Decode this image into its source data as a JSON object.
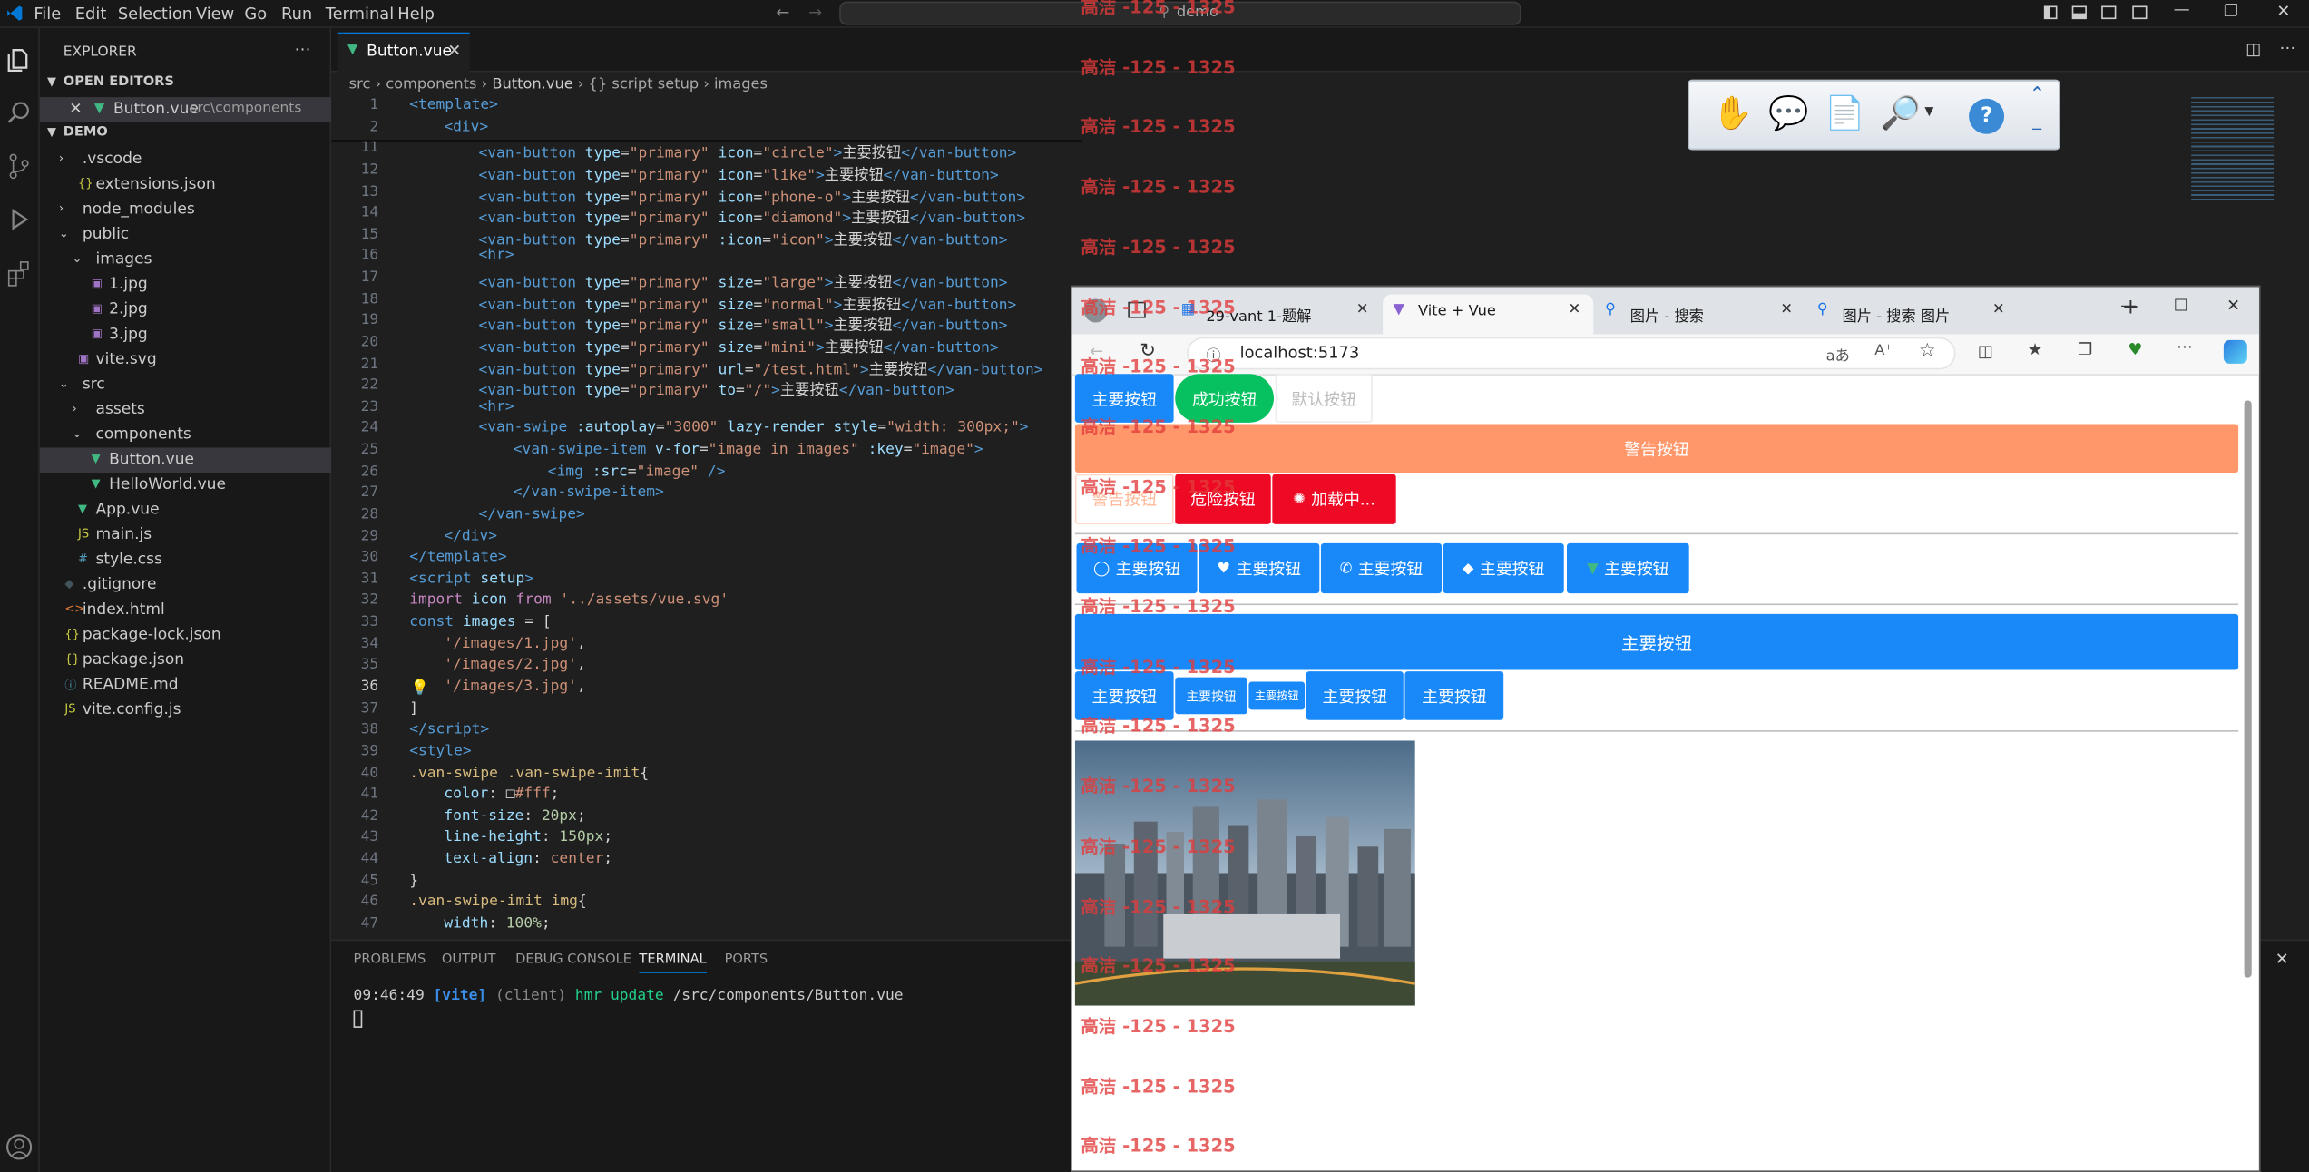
{
  "menu": [
    "File",
    "Edit",
    "Selection",
    "View",
    "Go",
    "Run",
    "Terminal",
    "Help"
  ],
  "search": {
    "text": "demo"
  },
  "explorer": {
    "title": "EXPLORER",
    "open_editors_label": "OPEN EDITORS",
    "open_file": "Button.vue",
    "open_file_path": "src\\components",
    "project": "DEMO",
    "items": [
      ".vscode",
      "extensions.json",
      "node_modules",
      "public",
      "images",
      "1.jpg",
      "2.jpg",
      "3.jpg",
      "vite.svg",
      "src",
      "assets",
      "components",
      "Button.vue",
      "HelloWorld.vue",
      "App.vue",
      "main.js",
      "style.css",
      ".gitignore",
      "index.html",
      "package-lock.json",
      "package.json",
      "README.md",
      "vite.config.js"
    ]
  },
  "editor": {
    "tab_label": "Button.vue",
    "breadcrumb": [
      "src",
      "components",
      "Button.vue",
      "{} script setup",
      "images"
    ],
    "lines": [
      {
        "n": "1",
        "html": "<span class='tag'>&lt;template&gt;</span>",
        "indent": 0
      },
      {
        "n": "2",
        "html": "<span class='tag'>&lt;div&gt;</span>",
        "indent": 1
      },
      {
        "n": "11",
        "html": "<span class='tag'>&lt;van-button</span> <span class='attr'>type</span>=<span class='str'>\"primary\"</span> <span class='attr'>icon</span>=<span class='str'>\"circle\"</span><span class='tag'>&gt;</span><span class='txt'>主要按钮</span><span class='tag'>&lt;/van-button&gt;</span>",
        "indent": 2
      },
      {
        "n": "12",
        "html": "<span class='tag'>&lt;van-button</span> <span class='attr'>type</span>=<span class='str'>\"primary\"</span> <span class='attr'>icon</span>=<span class='str'>\"like\"</span><span class='tag'>&gt;</span><span class='txt'>主要按钮</span><span class='tag'>&lt;/van-button&gt;</span>",
        "indent": 2
      },
      {
        "n": "13",
        "html": "<span class='tag'>&lt;van-button</span> <span class='attr'>type</span>=<span class='str'>\"primary\"</span> <span class='attr'>icon</span>=<span class='str'>\"phone-o\"</span><span class='tag'>&gt;</span><span class='txt'>主要按钮</span><span class='tag'>&lt;/van-button&gt;</span>",
        "indent": 2
      },
      {
        "n": "14",
        "html": "<span class='tag'>&lt;van-button</span> <span class='attr'>type</span>=<span class='str'>\"primary\"</span> <span class='attr'>icon</span>=<span class='str'>\"diamond\"</span><span class='tag'>&gt;</span><span class='txt'>主要按钮</span><span class='tag'>&lt;/van-button&gt;</span>",
        "indent": 2
      },
      {
        "n": "15",
        "html": "<span class='tag'>&lt;van-button</span> <span class='attr'>type</span>=<span class='str'>\"primary\"</span> <span class='attr'>:icon</span>=<span class='str'>\"icon\"</span><span class='tag'>&gt;</span><span class='txt'>主要按钮</span><span class='tag'>&lt;/van-button&gt;</span>",
        "indent": 2
      },
      {
        "n": "16",
        "html": "<span class='tag'>&lt;hr&gt;</span>",
        "indent": 2
      },
      {
        "n": "17",
        "html": "<span class='tag'>&lt;van-button</span> <span class='attr'>type</span>=<span class='str'>\"primary\"</span> <span class='attr'>size</span>=<span class='str'>\"large\"</span><span class='tag'>&gt;</span><span class='txt'>主要按钮</span><span class='tag'>&lt;/van-button&gt;</span>",
        "indent": 2
      },
      {
        "n": "18",
        "html": "<span class='tag'>&lt;van-button</span> <span class='attr'>type</span>=<span class='str'>\"primary\"</span> <span class='attr'>size</span>=<span class='str'>\"normal\"</span><span class='tag'>&gt;</span><span class='txt'>主要按钮</span><span class='tag'>&lt;/van-button&gt;</span>",
        "indent": 2
      },
      {
        "n": "19",
        "html": "<span class='tag'>&lt;van-button</span> <span class='attr'>type</span>=<span class='str'>\"primary\"</span> <span class='attr'>size</span>=<span class='str'>\"small\"</span><span class='tag'>&gt;</span><span class='txt'>主要按钮</span><span class='tag'>&lt;/van-button&gt;</span>",
        "indent": 2
      },
      {
        "n": "20",
        "html": "<span class='tag'>&lt;van-button</span> <span class='attr'>type</span>=<span class='str'>\"primary\"</span> <span class='attr'>size</span>=<span class='str'>\"mini\"</span><span class='tag'>&gt;</span><span class='txt'>主要按钮</span><span class='tag'>&lt;/van-button&gt;</span>",
        "indent": 2
      },
      {
        "n": "21",
        "html": "<span class='tag'>&lt;van-button</span> <span class='attr'>type</span>=<span class='str'>\"primary\"</span> <span class='attr'>url</span>=<span class='str'>\"/test.html\"</span><span class='tag'>&gt;</span><span class='txt'>主要按钮</span><span class='tag'>&lt;/van-button&gt;</span>",
        "indent": 2
      },
      {
        "n": "22",
        "html": "<span class='tag'>&lt;van-button</span> <span class='attr'>type</span>=<span class='str'>\"primary\"</span> <span class='attr'>to</span>=<span class='str'>\"/\"</span><span class='tag'>&gt;</span><span class='txt'>主要按钮</span><span class='tag'>&lt;/van-button&gt;</span>",
        "indent": 2
      },
      {
        "n": "23",
        "html": "<span class='tag'>&lt;hr&gt;</span>",
        "indent": 2
      },
      {
        "n": "24",
        "html": "<span class='tag'>&lt;van-swipe</span> <span class='attr'>:autoplay</span>=<span class='str'>\"3000\"</span> <span class='attr'>lazy-render</span> <span class='attr'>style</span>=<span class='str'>\"width: 300px;\"</span><span class='tag'>&gt;</span>",
        "indent": 2
      },
      {
        "n": "25",
        "html": "<span class='tag'>&lt;van-swipe-item</span> <span class='attr'>v-for</span>=<span class='str'>\"image in images\"</span> <span class='attr'>:key</span>=<span class='str'>\"image\"</span><span class='tag'>&gt;</span>",
        "indent": 3
      },
      {
        "n": "26",
        "html": "<span class='tag'>&lt;img</span> <span class='attr'>:src</span>=<span class='str'>\"image\"</span> <span class='tag'>/&gt;</span>",
        "indent": 4
      },
      {
        "n": "27",
        "html": "<span class='tag'>&lt;/van-swipe-item&gt;</span>",
        "indent": 3
      },
      {
        "n": "28",
        "html": "<span class='tag'>&lt;/van-swipe&gt;</span>",
        "indent": 2
      },
      {
        "n": "29",
        "html": "<span class='tag'>&lt;/div&gt;</span>",
        "indent": 1
      },
      {
        "n": "30",
        "html": "<span class='tag'>&lt;/template&gt;</span>",
        "indent": 0
      },
      {
        "n": "31",
        "html": "<span class='tag'>&lt;script</span> <span class='attr'>setup</span><span class='tag'>&gt;</span>",
        "indent": 0
      },
      {
        "n": "32",
        "html": "<span class='kw'>import</span> <span class='var'>icon</span> <span class='kw'>from</span> <span class='str'>'../assets/vue.svg'</span>",
        "indent": 0
      },
      {
        "n": "33",
        "html": "<span class='tag'>const</span> <span class='var'>images</span> <span class='txt'>= [</span>",
        "indent": 0
      },
      {
        "n": "34",
        "html": "<span class='str'>'/images/1.jpg'</span><span class='txt'>,</span>",
        "indent": 1
      },
      {
        "n": "35",
        "html": "<span class='str'>'/images/2.jpg'</span><span class='txt'>,</span>",
        "indent": 1
      },
      {
        "n": "36",
        "html": "<span class='str'>'/images/3.jpg'</span><span class='txt'>,</span>",
        "indent": 1
      },
      {
        "n": "37",
        "html": "<span class='txt'>]</span>",
        "indent": 0
      },
      {
        "n": "38",
        "html": "<span class='tag'>&lt;/script&gt;</span>",
        "indent": 0
      },
      {
        "n": "39",
        "html": "<span class='tag'>&lt;style&gt;</span>",
        "indent": 0
      },
      {
        "n": "40",
        "html": "<span class='sel-c'>.van-swipe .van-swipe-imit</span><span class='txt'>{</span>",
        "indent": 0
      },
      {
        "n": "41",
        "html": "<span class='prop'>color</span><span class='txt'>: </span><span class='txt'>&#9633;</span><span class='str'>#fff</span><span class='txt'>;</span>",
        "indent": 1
      },
      {
        "n": "42",
        "html": "<span class='prop'>font-size</span><span class='txt'>: </span><span class='num'>20px</span><span class='txt'>;</span>",
        "indent": 1
      },
      {
        "n": "43",
        "html": "<span class='prop'>line-height</span><span class='txt'>: </span><span class='num'>150px</span><span class='txt'>;</span>",
        "indent": 1
      },
      {
        "n": "44",
        "html": "<span class='prop'>text-align</span><span class='txt'>: </span><span class='str'>center</span><span class='txt'>;</span>",
        "indent": 1
      },
      {
        "n": "45",
        "html": "<span class='txt'>}</span>",
        "indent": 0
      },
      {
        "n": "46",
        "html": "<span class='sel-c'>.van-swipe-imit img</span><span class='txt'>{</span>",
        "indent": 0
      },
      {
        "n": "47",
        "html": "<span class='prop'>width</span><span class='txt'>: </span><span class='num'>100%</span><span class='txt'>;</span>",
        "indent": 1
      }
    ]
  },
  "panel": {
    "tabs": [
      "PROBLEMS",
      "OUTPUT",
      "DEBUG CONSOLE",
      "TERMINAL",
      "PORTS"
    ],
    "active_tab": "TERMINAL",
    "terminal_time": "09:46:49",
    "terminal_tag": "[vite]",
    "terminal_client": "(client)",
    "terminal_msg": "hmr update",
    "terminal_path": "/src/components/Button.vue"
  },
  "browser": {
    "tabs": [
      "29-vant 1-题解",
      "Vite + Vue",
      "图片 - 搜索",
      "图片 - 搜索 图片"
    ],
    "active_tab": "Vite + Vue",
    "url": "localhost:5173",
    "row1": [
      "主要按钮",
      "成功按钮",
      "默认按钮"
    ],
    "warning_block": "警告按钮",
    "row2": [
      "警告按钮",
      "危险按钮",
      "加载中..."
    ],
    "icon_buttons": [
      "主要按钮",
      "主要按钮",
      "主要按钮",
      "主要按钮",
      "主要按钮"
    ],
    "large_button": "主要按钮",
    "size_buttons": [
      "主要按钮",
      "主要按钮",
      "主要按钮",
      "主要按钮",
      "主要按钮"
    ],
    "colors": {
      "primary": "#1989fa",
      "success": "#07c160",
      "warning": "#ff976a",
      "danger": "#ee0a24"
    }
  },
  "watermark_text": "高洁 -125 - 1325"
}
